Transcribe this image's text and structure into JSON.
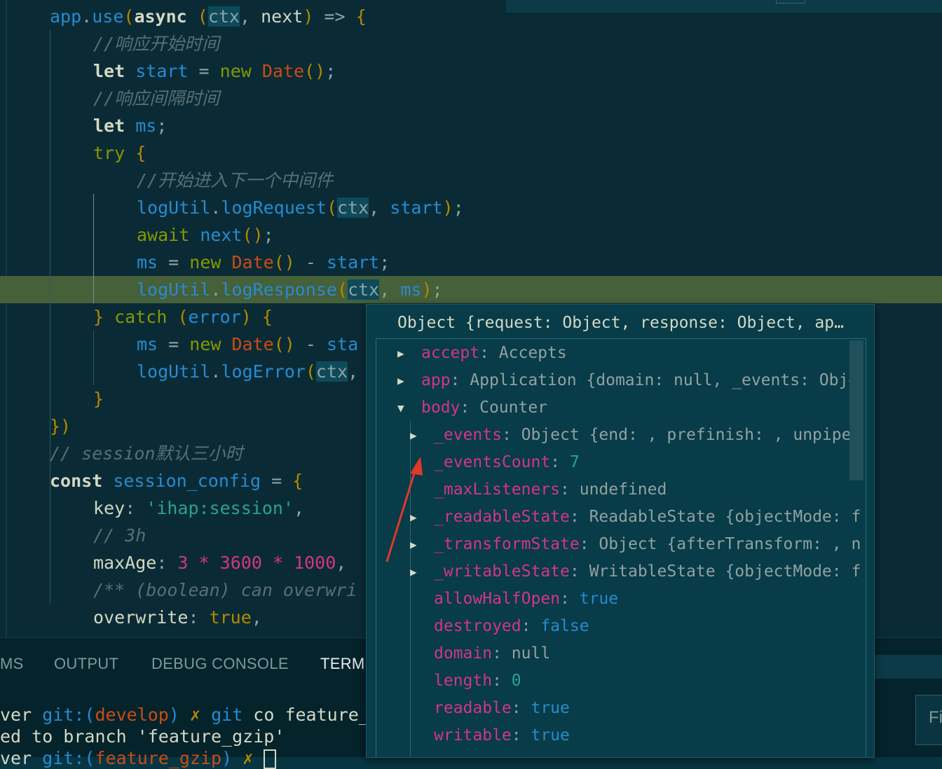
{
  "editor": {
    "lines": [
      {
        "indent": 0,
        "tokens": [
          [
            "ident",
            "app"
          ],
          [
            "pun",
            "."
          ],
          [
            "ident",
            "use"
          ],
          [
            "br",
            "("
          ],
          [
            "kw",
            "async"
          ],
          [
            "pun",
            " "
          ],
          [
            "br",
            "("
          ],
          [
            "ctxh",
            "ctx"
          ],
          [
            "pun",
            ", "
          ],
          [
            "plain",
            "next"
          ],
          [
            "br",
            ")"
          ],
          [
            "pun",
            " => "
          ],
          [
            "br",
            "{"
          ]
        ]
      },
      {
        "indent": 1,
        "tokens": [
          [
            "cm",
            "//响应开始时间"
          ]
        ]
      },
      {
        "indent": 1,
        "tokens": [
          [
            "kw",
            "let"
          ],
          [
            "pun",
            " "
          ],
          [
            "ident",
            "start"
          ],
          [
            "pun",
            " = "
          ],
          [
            "flow",
            "new"
          ],
          [
            "pun",
            " "
          ],
          [
            "cls",
            "Date"
          ],
          [
            "br",
            "()"
          ],
          [
            "pun",
            ";"
          ]
        ]
      },
      {
        "indent": 1,
        "tokens": [
          [
            "cm",
            "//响应间隔时间"
          ]
        ]
      },
      {
        "indent": 1,
        "tokens": [
          [
            "kw",
            "let"
          ],
          [
            "pun",
            " "
          ],
          [
            "ident",
            "ms"
          ],
          [
            "pun",
            ";"
          ]
        ]
      },
      {
        "indent": 1,
        "tokens": [
          [
            "flow",
            "try"
          ],
          [
            "pun",
            " "
          ],
          [
            "br",
            "{"
          ]
        ]
      },
      {
        "indent": 2,
        "tokens": [
          [
            "cm",
            "//开始进入下一个中间件"
          ]
        ]
      },
      {
        "indent": 2,
        "tokens": [
          [
            "ident",
            "logUtil"
          ],
          [
            "pun",
            "."
          ],
          [
            "ident",
            "logRequest"
          ],
          [
            "br",
            "("
          ],
          [
            "ctxh",
            "ctx"
          ],
          [
            "pun",
            ", "
          ],
          [
            "ident",
            "start"
          ],
          [
            "br",
            ")"
          ],
          [
            "pun",
            ";"
          ]
        ]
      },
      {
        "indent": 2,
        "tokens": [
          [
            "flow",
            "await"
          ],
          [
            "pun",
            " "
          ],
          [
            "ident",
            "next"
          ],
          [
            "br",
            "()"
          ],
          [
            "pun",
            ";"
          ]
        ]
      },
      {
        "indent": 2,
        "tokens": [
          [
            "ident",
            "ms"
          ],
          [
            "pun",
            " = "
          ],
          [
            "flow",
            "new"
          ],
          [
            "pun",
            " "
          ],
          [
            "cls",
            "Date"
          ],
          [
            "br",
            "()"
          ],
          [
            "pun",
            " - "
          ],
          [
            "ident",
            "start"
          ],
          [
            "pun",
            ";"
          ]
        ]
      },
      {
        "indent": 2,
        "hl": true,
        "tokens": [
          [
            "ident",
            "logUtil"
          ],
          [
            "pun",
            "."
          ],
          [
            "ident",
            "logResponse"
          ],
          [
            "br",
            "("
          ],
          [
            "ctxh",
            "ctx"
          ],
          [
            "pun",
            ", "
          ],
          [
            "ident",
            "ms"
          ],
          [
            "br",
            ")"
          ],
          [
            "pun",
            ";"
          ]
        ]
      },
      {
        "indent": 1,
        "tokens": [
          [
            "br",
            "}"
          ],
          [
            "pun",
            " "
          ],
          [
            "flow",
            "catch"
          ],
          [
            "pun",
            " "
          ],
          [
            "br",
            "("
          ],
          [
            "ident",
            "error"
          ],
          [
            "br",
            ")"
          ],
          [
            "pun",
            " "
          ],
          [
            "br",
            "{"
          ]
        ]
      },
      {
        "indent": 2,
        "tokens": [
          [
            "ident",
            "ms"
          ],
          [
            "pun",
            " = "
          ],
          [
            "flow",
            "new"
          ],
          [
            "pun",
            " "
          ],
          [
            "cls",
            "Date"
          ],
          [
            "br",
            "()"
          ],
          [
            "pun",
            " - "
          ],
          [
            "ident",
            "sta"
          ]
        ]
      },
      {
        "indent": 2,
        "tokens": [
          [
            "ident",
            "logUtil"
          ],
          [
            "pun",
            "."
          ],
          [
            "ident",
            "logError"
          ],
          [
            "br",
            "("
          ],
          [
            "ctxh",
            "ctx"
          ],
          [
            "pun",
            ","
          ]
        ]
      },
      {
        "indent": 1,
        "tokens": [
          [
            "br",
            "}"
          ]
        ]
      },
      {
        "indent": 0,
        "tokens": [
          [
            "br",
            "})"
          ]
        ]
      },
      {
        "indent": 0,
        "tokens": [
          [
            "cm",
            "// session默认三小时"
          ]
        ]
      },
      {
        "indent": 0,
        "tokens": [
          [
            "kw",
            "const"
          ],
          [
            "pun",
            " "
          ],
          [
            "ident",
            "session_config"
          ],
          [
            "pun",
            " = "
          ],
          [
            "br",
            "{"
          ]
        ]
      },
      {
        "indent": 1,
        "tokens": [
          [
            "plain",
            "key"
          ],
          [
            "pun",
            ": "
          ],
          [
            "str",
            "'ihap:session'"
          ],
          [
            "pun",
            ","
          ]
        ]
      },
      {
        "indent": 1,
        "tokens": [
          [
            "cm",
            "// 3h"
          ]
        ]
      },
      {
        "indent": 1,
        "tokens": [
          [
            "plain",
            "maxAge"
          ],
          [
            "pun",
            ": "
          ],
          [
            "num",
            "3"
          ],
          [
            "pun",
            " "
          ],
          [
            "num",
            "*"
          ],
          [
            "pun",
            " "
          ],
          [
            "num",
            "3600"
          ],
          [
            "pun",
            " "
          ],
          [
            "num",
            "*"
          ],
          [
            "pun",
            " "
          ],
          [
            "num",
            "1000"
          ],
          [
            "pun",
            ","
          ]
        ]
      },
      {
        "indent": 1,
        "tokens": [
          [
            "cm",
            "/** (boolean) can overwri"
          ]
        ]
      },
      {
        "indent": 1,
        "tokens": [
          [
            "plain",
            "overwrite"
          ],
          [
            "pun",
            ": "
          ],
          [
            "br",
            "true"
          ],
          [
            "pun",
            ","
          ]
        ]
      }
    ]
  },
  "panel": {
    "tabs": [
      "MS",
      "OUTPUT",
      "DEBUG CONSOLE",
      "TERMI"
    ],
    "active_tab": "TERMI",
    "terminal_lines": [
      [
        [
          "plain",
          "ver "
        ],
        [
          "t-git",
          "git:("
        ],
        [
          "t-branch",
          "develop"
        ],
        [
          "t-git",
          ")"
        ],
        [
          "plain",
          " "
        ],
        [
          "t-cross",
          "✗"
        ],
        [
          "plain",
          " "
        ],
        [
          "t-git",
          "git"
        ],
        [
          "plain",
          " co feature_"
        ]
      ],
      [
        [
          "plain",
          "ed to branch 'feature_gzip'"
        ]
      ],
      [
        [
          "plain",
          "ver "
        ],
        [
          "t-git",
          "git:("
        ],
        [
          "t-branch",
          "feature_gzip"
        ],
        [
          "t-git",
          ")"
        ],
        [
          "plain",
          " "
        ],
        [
          "t-cross",
          "✗"
        ],
        [
          "plain",
          " "
        ]
      ]
    ],
    "side_button": "Fi"
  },
  "hover": {
    "title": "Object {request: Object, response: Object, ap…",
    "rows": [
      {
        "level": 0,
        "twisty": "right",
        "name": "accept",
        "value": "Accepts",
        "vtype": "pval"
      },
      {
        "level": 0,
        "twisty": "right",
        "name": "app",
        "value": "Application {domain: null, _events: Obje",
        "vtype": "pval"
      },
      {
        "level": 0,
        "twisty": "down",
        "name": "body",
        "value": "Counter",
        "vtype": "pval"
      },
      {
        "level": 1,
        "twisty": "right",
        "name": "_events",
        "value": "Object {end: , prefinish: , unpipe:",
        "vtype": "pval"
      },
      {
        "level": 1,
        "twisty": "none",
        "name": "_eventsCount",
        "value": "7",
        "vtype": "pnum"
      },
      {
        "level": 1,
        "twisty": "none",
        "name": "_maxListeners",
        "value": "undefined",
        "vtype": "pval"
      },
      {
        "level": 1,
        "twisty": "right",
        "name": "_readableState",
        "value": "ReadableState {objectMode: f",
        "vtype": "pval"
      },
      {
        "level": 1,
        "twisty": "right",
        "name": "_transformState",
        "value": "Object {afterTransform: , n",
        "vtype": "pval"
      },
      {
        "level": 1,
        "twisty": "right",
        "name": "_writableState",
        "value": "WritableState {objectMode: f",
        "vtype": "pval"
      },
      {
        "level": 1,
        "twisty": "none",
        "name": "allowHalfOpen",
        "value": "true",
        "vtype": "pbool"
      },
      {
        "level": 1,
        "twisty": "none",
        "name": "destroyed",
        "value": "false",
        "vtype": "pbool"
      },
      {
        "level": 1,
        "twisty": "none",
        "name": "domain",
        "value": "null",
        "vtype": "pval"
      },
      {
        "level": 1,
        "twisty": "none",
        "name": "length",
        "value": "0",
        "vtype": "pnum"
      },
      {
        "level": 1,
        "twisty": "none",
        "name": "readable",
        "value": "true",
        "vtype": "pbool"
      },
      {
        "level": 1,
        "twisty": "none",
        "name": "writable",
        "value": "true",
        "vtype": "pbool"
      }
    ]
  },
  "colors": {
    "annotation_arrow": "#e0382c",
    "highlight_line": "#46603a"
  }
}
